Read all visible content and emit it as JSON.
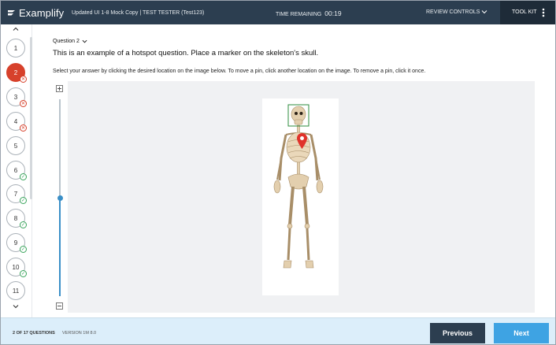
{
  "header": {
    "logo_text": "Examplify",
    "exam_title": "Updated UI 1-8 Mock Copy | TEST TESTER (Test123)",
    "timer_label": "TIME REMAINING",
    "timer_value": "00:19",
    "review_label": "REVIEW CONTROLS",
    "toolkit_label": "TOOL KIT",
    "colors": {
      "bar": "#2c3e50",
      "toolkit": "#1e2b38"
    }
  },
  "sidebar": {
    "questions": [
      {
        "label": "1",
        "status": "none"
      },
      {
        "label": "2",
        "status": "current-incorrect"
      },
      {
        "label": "3",
        "status": "incorrect"
      },
      {
        "label": "4",
        "status": "incorrect"
      },
      {
        "label": "5",
        "status": "none"
      },
      {
        "label": "6",
        "status": "answered"
      },
      {
        "label": "7",
        "status": "answered"
      },
      {
        "label": "8",
        "status": "answered"
      },
      {
        "label": "9",
        "status": "answered"
      },
      {
        "label": "10",
        "status": "answered"
      },
      {
        "label": "11",
        "status": "none"
      }
    ],
    "colors": {
      "current": "#d7412b",
      "answered": "#3aa55c"
    }
  },
  "question": {
    "number_label": "Question 2",
    "text": "This is an example of a hotspot question. Place a marker on the skeleton's skull.",
    "instructions": "Select your answer by clicking the desired location on the image below. To move a pin, click another location on the image. To remove a pin, click it once."
  },
  "zoom": {
    "level_fraction": 0.5
  },
  "footer": {
    "progress": "2 OF 17 QUESTIONS",
    "version": "VERSION 1M 8.0",
    "previous_label": "Previous",
    "next_label": "Next",
    "colors": {
      "previous": "#2c3e50",
      "next": "#3ea3e3"
    }
  }
}
